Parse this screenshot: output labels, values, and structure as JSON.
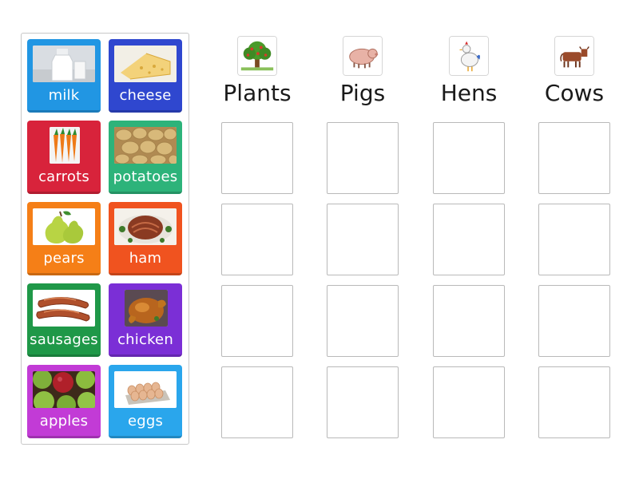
{
  "cards": [
    {
      "label": "milk",
      "color": "#2196e3",
      "image": "milk-bottle-image"
    },
    {
      "label": "cheese",
      "color": "#2f47cf",
      "image": "cheese-image"
    },
    {
      "label": "carrots",
      "color": "#d8233b",
      "image": "carrots-image"
    },
    {
      "label": "potatoes",
      "color": "#2db37a",
      "image": "potatoes-image"
    },
    {
      "label": "pears",
      "color": "#f57f17",
      "image": "pears-image"
    },
    {
      "label": "ham",
      "color": "#f0531f",
      "image": "ham-image"
    },
    {
      "label": "sausages",
      "color": "#1f9848",
      "image": "sausages-image"
    },
    {
      "label": "chicken",
      "color": "#7b2fd6",
      "image": "roast-chicken-image"
    },
    {
      "label": "apples",
      "color": "#c23bd6",
      "image": "apples-image"
    },
    {
      "label": "eggs",
      "color": "#2aa6ec",
      "image": "eggs-image"
    }
  ],
  "columns": [
    {
      "title": "Plants",
      "icon": "tree-icon"
    },
    {
      "title": "Pigs",
      "icon": "pig-icon"
    },
    {
      "title": "Hens",
      "icon": "hen-icon"
    },
    {
      "title": "Cows",
      "icon": "cow-icon"
    }
  ],
  "rows_per_column": 4
}
